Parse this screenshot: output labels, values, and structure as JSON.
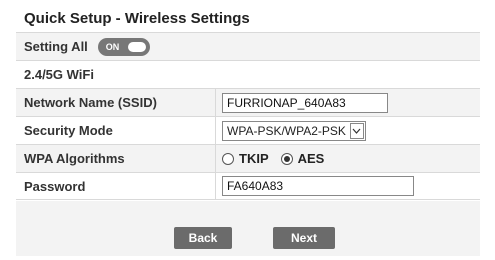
{
  "title": "Quick Setup - Wireless Settings",
  "setting_all": {
    "label": "Setting All",
    "toggle_text": "ON",
    "state": "on"
  },
  "section_header": "2.4/5G WiFi",
  "fields": {
    "ssid": {
      "label": "Network Name (SSID)",
      "value": "FURRIONAP_640A83"
    },
    "security": {
      "label": "Security Mode",
      "value": "WPA-PSK/WPA2-PSK"
    },
    "wpa": {
      "label": "WPA Algorithms",
      "options": [
        {
          "label": "TKIP",
          "selected": false
        },
        {
          "label": "AES",
          "selected": true
        }
      ]
    },
    "password": {
      "label": "Password",
      "value": "FA640A83"
    }
  },
  "buttons": {
    "back": "Back",
    "next": "Next"
  },
  "colors": {
    "button_bg": "#6b6b6b",
    "toggle_bg": "#777777",
    "alt_row_bg": "#f3f3f3",
    "border": "#d9d9d9"
  }
}
